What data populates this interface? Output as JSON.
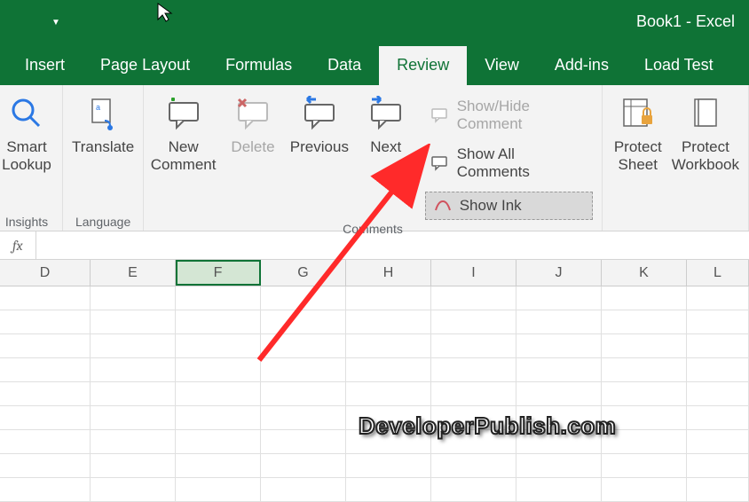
{
  "title": {
    "text": "Book1  -  Excel"
  },
  "tabs": {
    "insert": "Insert",
    "pagelayout": "Page Layout",
    "formulas": "Formulas",
    "data": "Data",
    "review": "Review",
    "view": "View",
    "addins": "Add-ins",
    "loadtest": "Load Test"
  },
  "ribbon": {
    "smartlookup": "Smart\nLookup",
    "translate": "Translate",
    "newcomment": "New\nComment",
    "delete": "Delete",
    "previous": "Previous",
    "next": "Next",
    "showhidecomment": "Show/Hide Comment",
    "showallcomments": "Show All Comments",
    "showink": "Show Ink",
    "protectsheet": "Protect\nSheet",
    "protectworkbook": "Protect\nWorkbook"
  },
  "groups": {
    "insights": "Insights",
    "language": "Language",
    "comments": "Comments"
  },
  "formula": {
    "fx": "fx"
  },
  "columns": [
    "D",
    "E",
    "F",
    "G",
    "H",
    "I",
    "J",
    "K",
    "L"
  ],
  "watermark": "DeveloperPublish.com"
}
